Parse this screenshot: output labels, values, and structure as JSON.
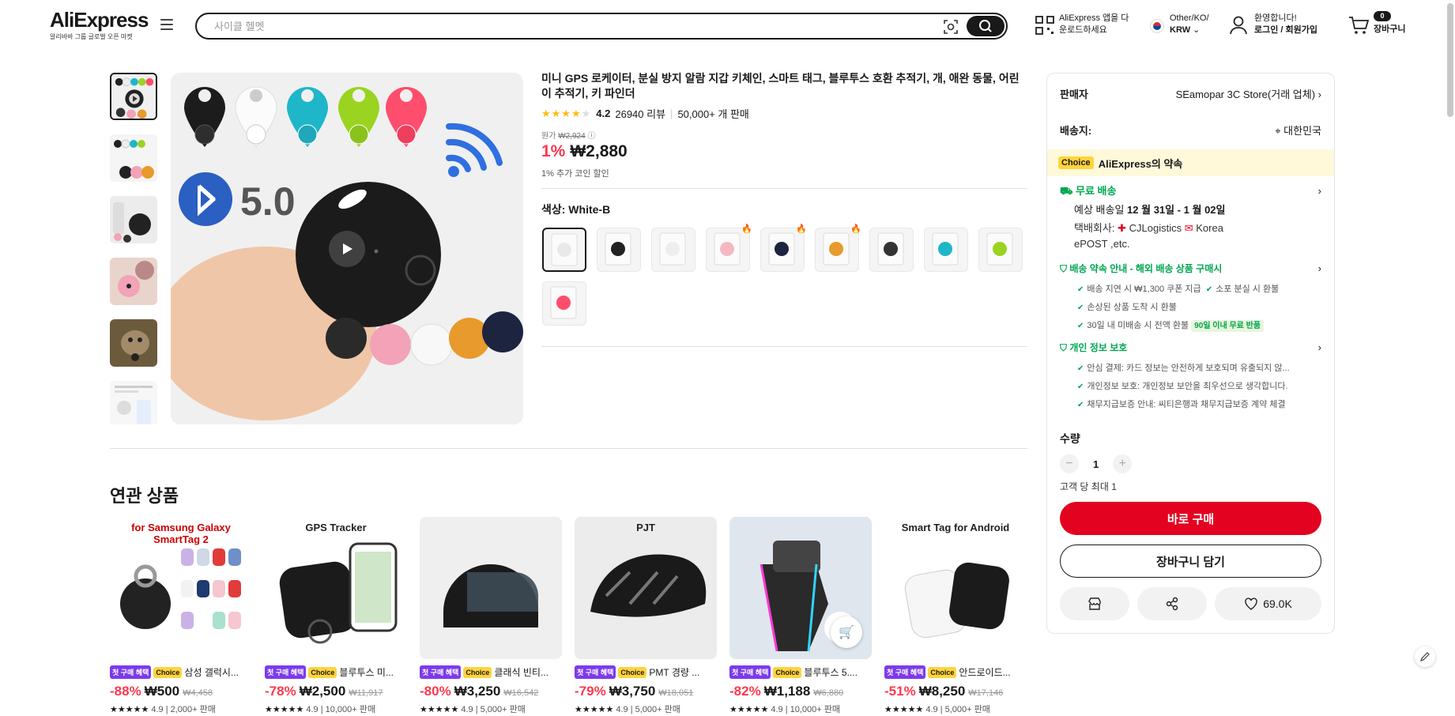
{
  "header": {
    "brand": "AliExpress",
    "brand_sub": "알리바바 그룹 글로벌 오픈 마켓",
    "search_placeholder": "사이클 헬멧",
    "app_line1": "AliExpress 앱을 다",
    "app_line2": "운로드하세요",
    "region_line1": "Other/KO/",
    "region_line2": "KRW",
    "account_line1": "환영합니다!",
    "account_line2": "로그인 / 회원가입",
    "cart_count": "0",
    "cart_label": "장바구니"
  },
  "product": {
    "title": "미니 GPS 로케이터, 분실 방지 알람 지갑 키체인, 스마트 태그, 블루투스 호환 추적기, 개, 애완 동물, 어린이 추적기, 키 파인더",
    "rating": "4.2",
    "reviews": "26940 리뷰",
    "sold": "50,000+ 개 판매",
    "orig_label": "원가",
    "orig_price": "₩2,924",
    "discount": "1%",
    "price": "₩2,880",
    "coin_note": "1% 추가 코인 할인",
    "color_label": "색상: White-B",
    "main_image_text": "5.0",
    "swatch_count": 10
  },
  "related": {
    "title": "연관 상품",
    "badge_first": "첫 구매 혜택",
    "badge_choice": "Choice",
    "items": [
      {
        "img_text": "for Samsung Galaxy SmartTag 2",
        "name": "삼성 갤럭시...",
        "discount": "-88%",
        "price": "₩500",
        "orig": "₩4,458",
        "sold": "4.9 | 2,000+ 판매"
      },
      {
        "img_text": "GPS Tracker",
        "name": "블루투스 미...",
        "discount": "-78%",
        "price": "₩2,500",
        "orig": "₩11,917",
        "sold": "4.9 | 10,000+ 판매"
      },
      {
        "img_text": "",
        "name": "클래식 빈티...",
        "discount": "-80%",
        "price": "₩3,250",
        "orig": "₩16,542",
        "sold": "4.9 | 5,000+ 판매"
      },
      {
        "img_text": "PJT",
        "name": "PMT 경량 ...",
        "discount": "-79%",
        "price": "₩3,750",
        "orig": "₩18,051",
        "sold": "4.9 | 5,000+ 판매"
      },
      {
        "img_text": "",
        "name": "블루투스 5....",
        "discount": "-82%",
        "price": "₩1,188",
        "orig": "₩6,880",
        "sold": "4.9 | 10,000+ 판매"
      },
      {
        "img_text": "Smart Tag for Android",
        "name": "안드로이드...",
        "discount": "-51%",
        "price": "₩8,250",
        "orig": "₩17,146",
        "sold": "4.9 | 5,000+ 판매"
      }
    ]
  },
  "panel": {
    "seller_label": "판매자",
    "seller_value": "SEamopar 3C Store(거래 업체)",
    "ship_to_label": "배송지:",
    "ship_to_value": "대한민국",
    "promise_tag": "Choice",
    "promise_text": "AliExpress의 약속",
    "free_ship": "무료 배송",
    "eta_prefix": "예상 배송일",
    "eta_value": "12 월 31일 - 1 월 02일",
    "carrier_line1_prefix": "택배회사:",
    "carrier_line1_a": "CJLogistics",
    "carrier_line1_b": "Korea",
    "carrier_line2": "ePOST ,etc.",
    "delivery_guarantee": "배송 약속 안내 - 해외 배송 상품 구매시",
    "dg_items": [
      "배송 지연 시 ₩1,300 쿠폰 지급",
      "소포 분실 시 환불",
      "손상된 상품 도착 시 환불",
      "30일 내 미배송 시 전액 환불"
    ],
    "dg_badge": "90일 이내 무료 반품",
    "privacy_title": "개인 정보 보호",
    "privacy_items": [
      "안심 결제: 카드 정보는 안전하게 보호되며 유출되지 않...",
      "개인정보 보호: 개인정보 보안을 최우선으로 생각합니다.",
      "채무지급보증 안내: 씨티은행과 채무지급보증 계약 체결"
    ],
    "qty_label": "수량",
    "qty_value": "1",
    "qty_limit": "고객 당 최대 1",
    "buy_now": "바로 구매",
    "add_cart": "장바구니 담기",
    "wishlist_count": "69.0K"
  },
  "colors": {
    "accent": "#e30220",
    "price_red": "#fd384f",
    "green": "#00a651",
    "choice_yellow": "#ffd43b",
    "first_purple": "#7c3aed"
  }
}
